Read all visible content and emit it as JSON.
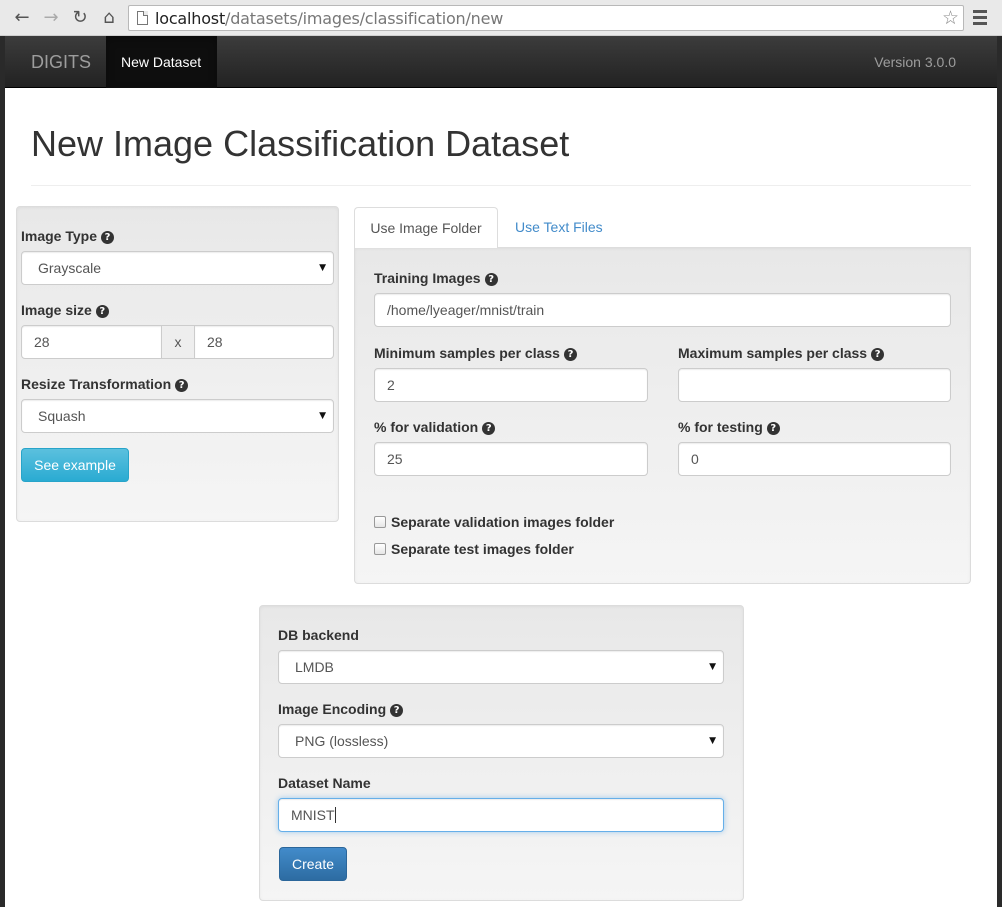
{
  "browser": {
    "url_host": "localhost",
    "url_path": "/datasets/images/classification/new"
  },
  "navbar": {
    "brand": "DIGITS",
    "active_item": "New Dataset",
    "version": "Version 3.0.0"
  },
  "page": {
    "title": "New Image Classification Dataset"
  },
  "image_options": {
    "image_type_label": "Image Type",
    "image_type_value": "Grayscale",
    "image_size_label": "Image size",
    "width_value": "28",
    "size_separator": "x",
    "height_value": "28",
    "resize_label": "Resize Transformation",
    "resize_value": "Squash",
    "see_example_label": "See example"
  },
  "tabs": [
    {
      "label": "Use Image Folder",
      "active": true
    },
    {
      "label": "Use Text Files",
      "active": false
    }
  ],
  "folder_form": {
    "training_images_label": "Training Images",
    "training_images_value": "/home/lyeager/mnist/train",
    "min_samples_label": "Minimum samples per class",
    "min_samples_value": "2",
    "max_samples_label": "Maximum samples per class",
    "max_samples_value": "",
    "validation_label": "% for validation",
    "validation_value": "25",
    "testing_label": "% for testing",
    "testing_value": "0",
    "separate_validation_label": "Separate validation images folder",
    "separate_test_label": "Separate test images folder"
  },
  "db_form": {
    "backend_label": "DB backend",
    "backend_value": "LMDB",
    "encoding_label": "Image Encoding",
    "encoding_value": "PNG (lossless)",
    "dataset_name_label": "Dataset Name",
    "dataset_name_value": "MNIST",
    "create_label": "Create"
  },
  "colors": {
    "link": "#428bca",
    "info_button": "#5bc0de",
    "primary_button": "#337ab7",
    "navbar": "#222222"
  }
}
